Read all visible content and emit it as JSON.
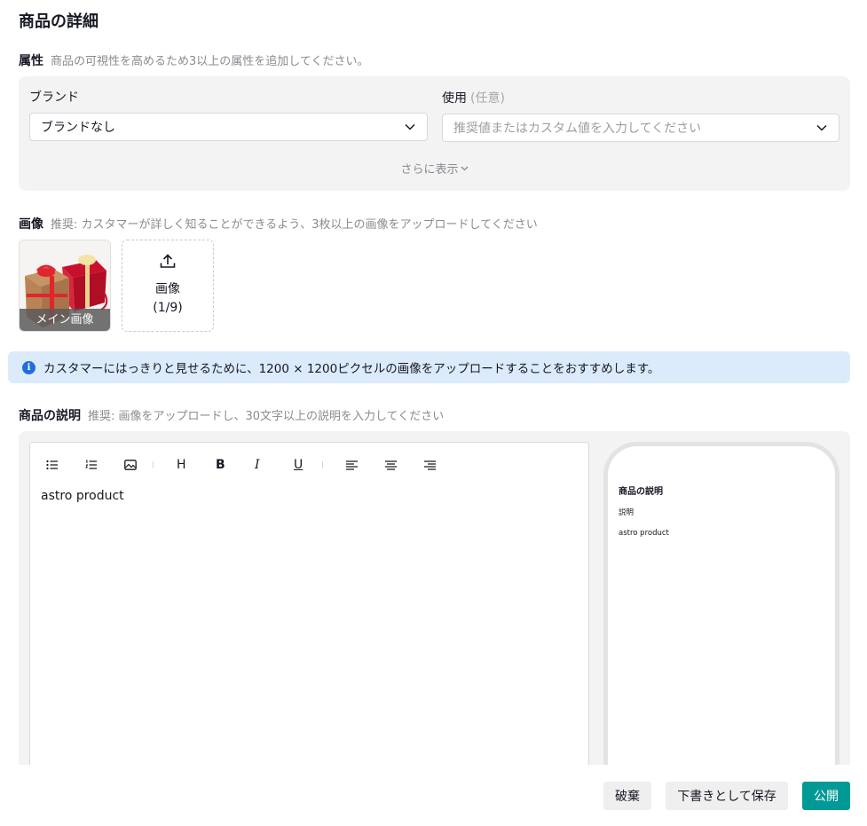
{
  "page": {
    "title": "商品の詳細"
  },
  "attributes": {
    "label": "属性",
    "hint": "商品の可視性を高めるため3以上の属性を追加してください。",
    "brand": {
      "label": "ブランド",
      "value": "ブランドなし"
    },
    "usage": {
      "label": "使用",
      "optional": "(任意)",
      "placeholder": "推奨値またはカスタム値を入力してください"
    },
    "more": "さらに表示"
  },
  "images": {
    "label": "画像",
    "hint": "推奨: カスタマーが詳しく知ることができるよう、3枚以上の画像をアップロードしてください",
    "main_caption": "メイン画像",
    "upload_label": "画像",
    "upload_count": "(1/9)"
  },
  "banner": {
    "text": "カスタマーにはっきりと見せるために、1200 × 1200ピクセルの画像をアップロードすることをおすすめします。"
  },
  "description": {
    "label": "商品の説明",
    "hint": "推奨: 画像をアップロードし、30文字以上の説明を入力してください",
    "editor_text": "astro product",
    "toolbar": {
      "heading": "H",
      "bold": "B",
      "italic": "I",
      "underline": "U"
    },
    "preview": {
      "title": "商品の説明",
      "subtitle": "説明",
      "text": "astro product"
    }
  },
  "footer": {
    "discard": "破棄",
    "save_draft": "下書きとして保存",
    "publish": "公開"
  },
  "colors": {
    "primary": "#009995",
    "info": "#1f6fde",
    "banner_bg": "#dcebfc",
    "panel_bg": "#f3f3f4"
  }
}
